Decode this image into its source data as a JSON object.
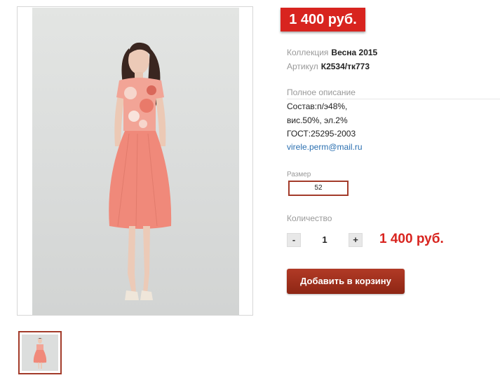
{
  "product": {
    "price_badge": "1 400 руб.",
    "collection_label": "Коллекция",
    "collection_value": "Весна 2015",
    "article_label": "Артикул",
    "article_value": "К2534/тк773"
  },
  "description": {
    "title": "Полное описание",
    "lines": [
      "Состав:п/э48%,",
      "вис.50%, эл.2%",
      "ГОСТ:25295-2003"
    ],
    "email": "virele.perm@mail.ru"
  },
  "size": {
    "label": "Размер",
    "selected": "52"
  },
  "quantity": {
    "label": "Количество",
    "minus": "-",
    "value": "1",
    "plus": "+",
    "total": "1 400 руб."
  },
  "cart": {
    "add_label": "Добавить в корзину"
  },
  "colors": {
    "accent_red": "#d8241f",
    "button_dark_red": "#9b2f1c",
    "dress_coral": "#f0897a"
  }
}
